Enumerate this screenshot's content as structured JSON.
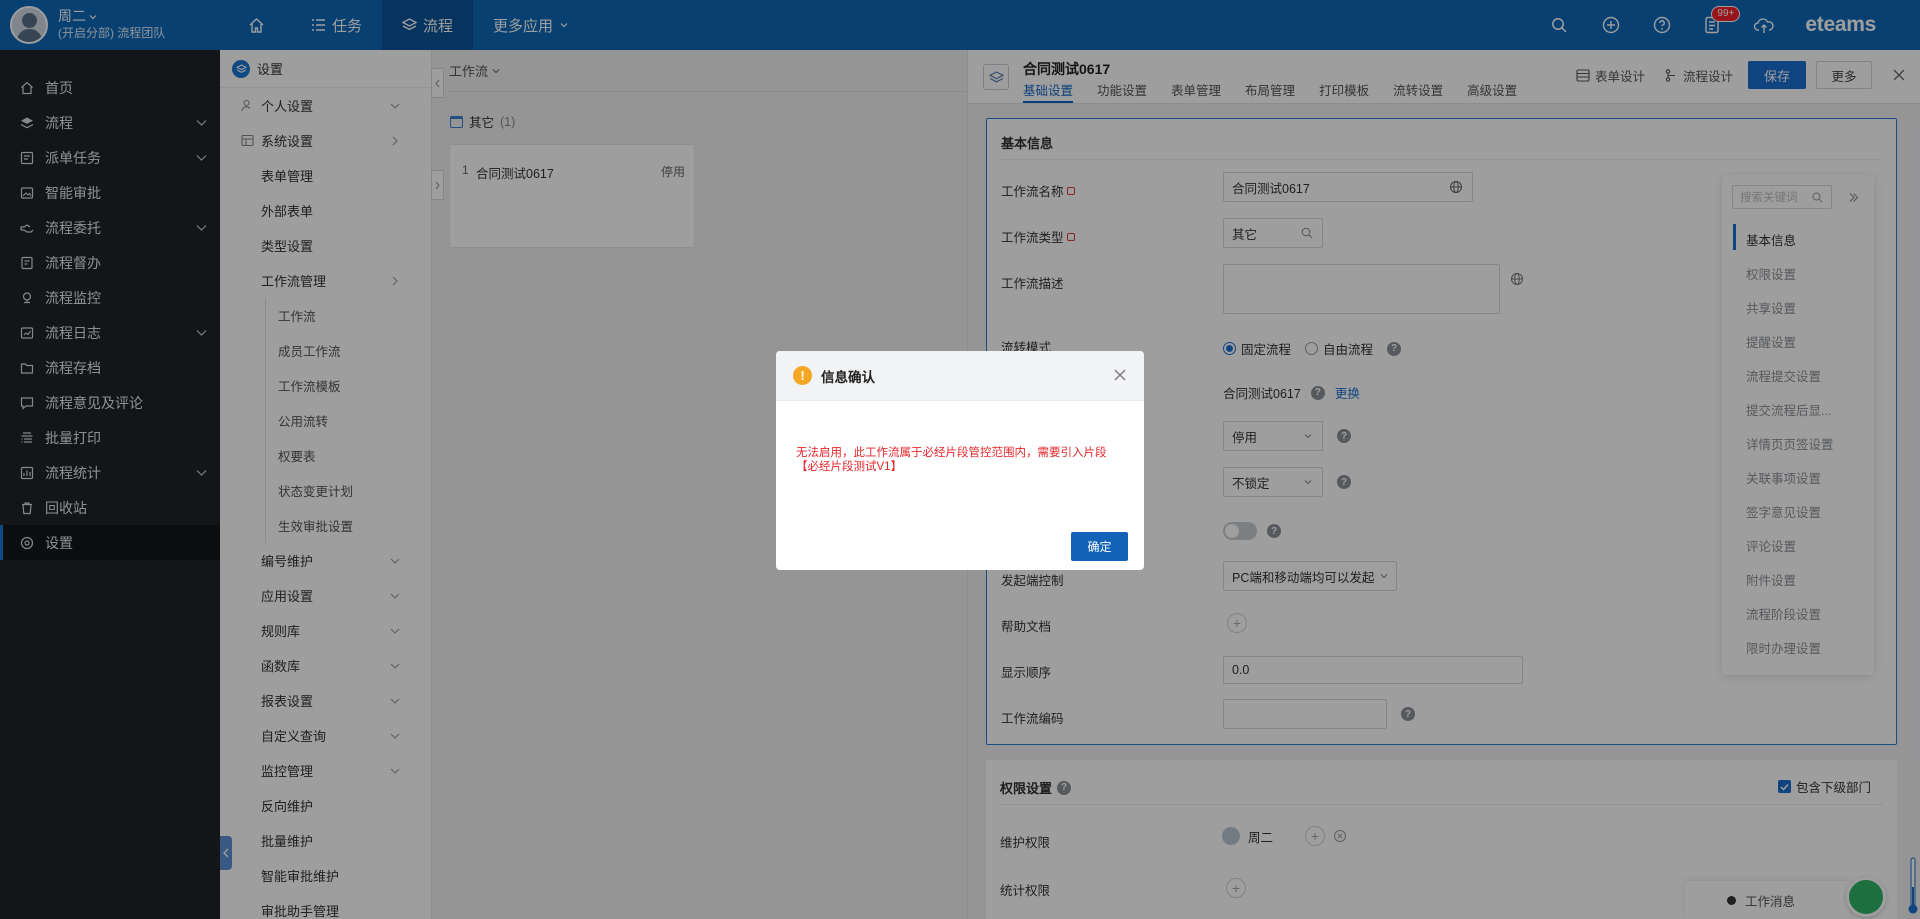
{
  "header": {
    "user_name": "周二",
    "user_team": "(开启分部) 流程团队",
    "nav": [
      {
        "label": ""
      },
      {
        "label": "任务"
      },
      {
        "label": "流程"
      },
      {
        "label": "更多应用"
      }
    ],
    "badge_count": "99+",
    "brand": "eteams"
  },
  "sidebar": {
    "items": [
      {
        "label": "首页",
        "icon": "home-icon"
      },
      {
        "label": "流程",
        "icon": "layers-icon"
      },
      {
        "label": "派单任务",
        "icon": "dispatch-icon"
      },
      {
        "label": "智能审批",
        "icon": "image-icon"
      },
      {
        "label": "流程委托",
        "icon": "hand-icon"
      },
      {
        "label": "流程督办",
        "icon": "doc-icon"
      },
      {
        "label": "流程监控",
        "icon": "pin-icon"
      },
      {
        "label": "流程日志",
        "icon": "log-icon"
      },
      {
        "label": "流程存档",
        "icon": "folder-icon"
      },
      {
        "label": "流程意见及评论",
        "icon": "comment-icon"
      },
      {
        "label": "批量打印",
        "icon": "print-icon"
      },
      {
        "label": "流程统计",
        "icon": "stats-icon"
      },
      {
        "label": "回收站",
        "icon": "trash-icon"
      },
      {
        "label": "设置",
        "icon": "gear-icon"
      }
    ]
  },
  "settings_menu": {
    "title": "设置",
    "top_items": [
      "个人设置",
      "系统设置"
    ],
    "system_children": [
      "表单管理",
      "外部表单",
      "类型设置",
      "工作流管理"
    ],
    "workflow_children": [
      "工作流",
      "成员工作流",
      "工作流模板",
      "公用流转",
      "权要表",
      "状态变更计划",
      "生效审批设置"
    ],
    "bottom_items": [
      "编号维护",
      "应用设置",
      "规则库",
      "函数库",
      "报表设置",
      "自定义查询",
      "监控管理",
      "反向维护",
      "批量维护",
      "智能审批维护",
      "审批助手管理"
    ]
  },
  "list": {
    "header": "工作流",
    "group_name": "其它",
    "group_count": "(1)",
    "items": [
      {
        "no": "1",
        "name": "合同测试0617",
        "status": "停用"
      }
    ]
  },
  "detail": {
    "title": "合同测试0617",
    "tabs": [
      "基础设置",
      "功能设置",
      "表单管理",
      "布局管理",
      "打印模板",
      "流转设置",
      "高级设置"
    ],
    "form_design": "表单设计",
    "flow_design": "流程设计",
    "save": "保存",
    "more": "更多",
    "basic": {
      "title": "基本信息",
      "name_label": "工作流名称",
      "name_value": "合同测试0617",
      "type_label": "工作流类型",
      "type_value": "其它",
      "desc_label": "工作流描述",
      "mode_label": "流转模式",
      "mode_fixed": "固定流程",
      "mode_free": "自由流程",
      "form_value": "合同测试0617",
      "form_change": "更换",
      "status_value": "停用",
      "lock_value": "不锁定",
      "launch_label": "发起端控制",
      "launch_value": "PC端和移动端均可以发起",
      "help_label": "帮助文档",
      "order_label": "显示顺序",
      "order_value": "0.0",
      "code_label": "工作流编码"
    },
    "anchor": {
      "search_placeholder": "搜索关键词",
      "items": [
        "基本信息",
        "权限设置",
        "共享设置",
        "提醒设置",
        "流程提交设置",
        "提交流程后显...",
        "详情页页签设置",
        "关联事项设置",
        "签字意见设置",
        "评论设置",
        "附件设置",
        "流程阶段设置",
        "限时办理设置"
      ]
    },
    "perm": {
      "title": "权限设置",
      "include_sub": "包含下级部门",
      "maintain_label": "维护权限",
      "maintain_user": "周二",
      "stats_label": "统计权限"
    },
    "message_label": "工作消息"
  },
  "dialog": {
    "title": "信息确认",
    "message_line1": "无法启用，此工作流属于必经片段管控范围内，需要引入片段",
    "message_line2": "【必经片段测试V1】",
    "ok": "确定"
  },
  "colors": {
    "header": "#0d68b9",
    "sidebar": "#1f2329",
    "accent": "#1b6fcf",
    "error_text": "#e8262b",
    "warning": "#f5a623"
  }
}
